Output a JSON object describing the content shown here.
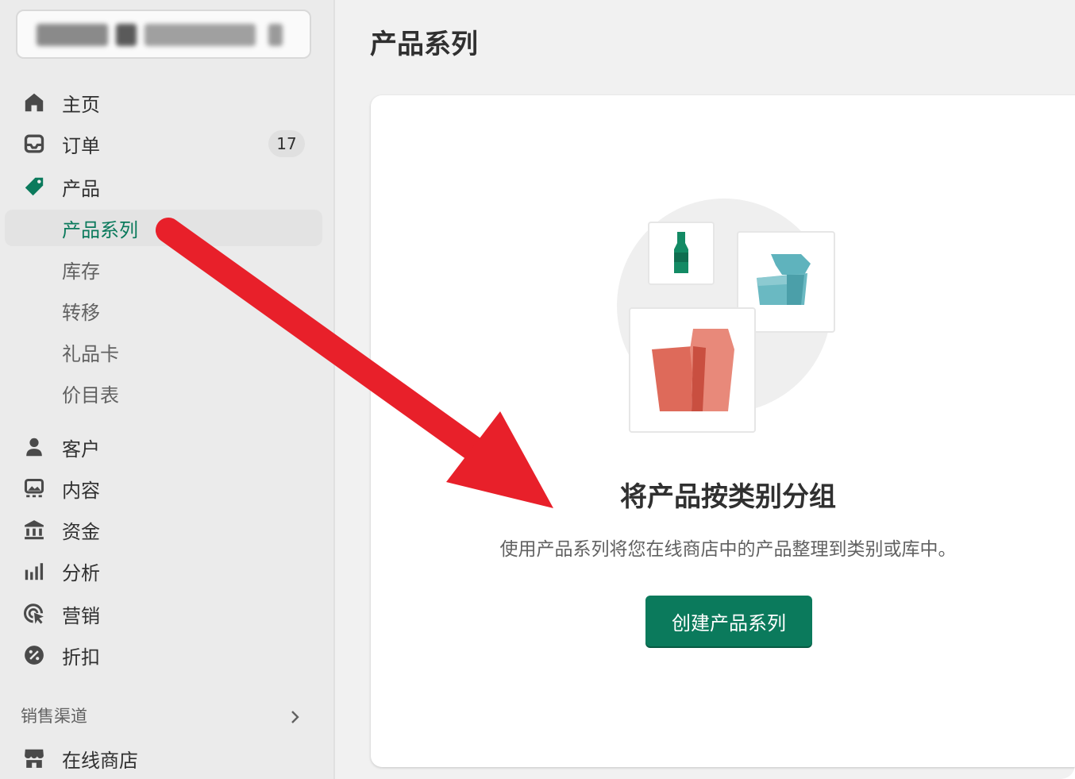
{
  "sidebar": {
    "store_selector": "",
    "items": [
      {
        "label": "主页",
        "icon": "home-icon"
      },
      {
        "label": "订单",
        "icon": "inbox-icon",
        "badge": "17"
      },
      {
        "label": "产品",
        "icon": "tag-icon"
      }
    ],
    "product_subitems": [
      {
        "label": "产品系列",
        "active": true
      },
      {
        "label": "库存"
      },
      {
        "label": "转移"
      },
      {
        "label": "礼品卡"
      },
      {
        "label": "价目表"
      }
    ],
    "items2": [
      {
        "label": "客户",
        "icon": "person-icon"
      },
      {
        "label": "内容",
        "icon": "content-icon"
      },
      {
        "label": "资金",
        "icon": "bank-icon"
      },
      {
        "label": "分析",
        "icon": "bar-chart-icon"
      },
      {
        "label": "营销",
        "icon": "marketing-icon"
      },
      {
        "label": "折扣",
        "icon": "discount-icon"
      }
    ],
    "sales_channels_title": "销售渠道",
    "channels": [
      {
        "label": "在线商店",
        "icon": "store-icon"
      }
    ]
  },
  "main": {
    "page_title": "产品系列",
    "empty_state": {
      "heading": "将产品按类别分组",
      "description": "使用产品系列将您在线商店中的产品整理到类别或库中。",
      "button_label": "创建产品系列"
    }
  },
  "colors": {
    "accent": "#0b7a5c",
    "annotation_arrow": "#e8202a"
  }
}
